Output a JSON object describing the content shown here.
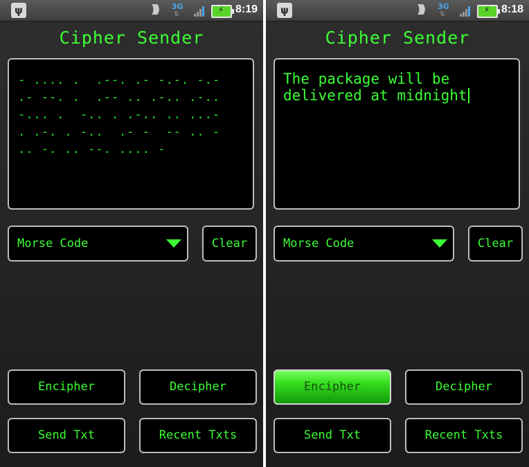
{
  "screens": [
    {
      "status": {
        "time": "8:19",
        "network": "3G"
      },
      "title": "Cipher Sender",
      "message_text": "- .... .  .--. .- -.-. -.-\n.- --. .  .-- .. .-.. .-..\n-... .  -.. . .-.. .. ...-\n. .-. . -..  .- -  -- .. -\n.. -. .. --. .... -",
      "cipher_select": "Morse Code",
      "buttons": {
        "clear": "Clear",
        "encipher": "Encipher",
        "decipher": "Decipher",
        "send": "Send Txt",
        "recent": "Recent Txts"
      }
    },
    {
      "status": {
        "time": "8:18",
        "network": "3G"
      },
      "title": "Cipher Sender",
      "message_text": "The package will be\ndelivered at midnight",
      "cipher_select": "Morse Code",
      "buttons": {
        "clear": "Clear",
        "encipher": "Encipher",
        "decipher": "Decipher",
        "send": "Send Txt",
        "recent": "Recent Txts"
      }
    }
  ],
  "colors": {
    "accent": "#3cff35",
    "background": "#262626",
    "field": "#000000",
    "border": "#bdbdbd",
    "pressed": "#38e020"
  }
}
